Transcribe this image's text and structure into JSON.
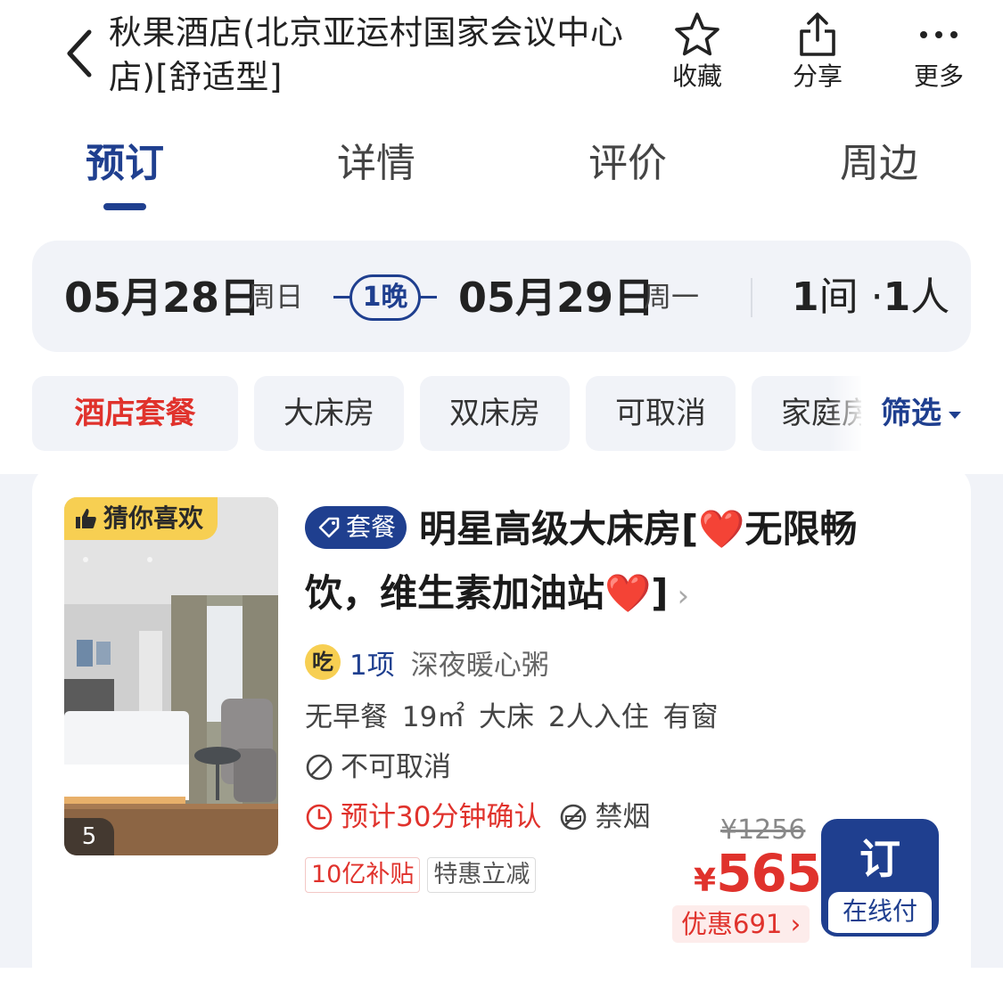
{
  "header": {
    "title": "秋果酒店(北京亚运村国家会议中心店)[舒适型]",
    "actions": [
      {
        "label": "收藏",
        "icon": "star-icon"
      },
      {
        "label": "分享",
        "icon": "share-icon"
      },
      {
        "label": "更多",
        "icon": "more-icon"
      }
    ]
  },
  "tabs": [
    {
      "label": "预订",
      "active": true
    },
    {
      "label": "详情",
      "active": false
    },
    {
      "label": "评价",
      "active": false
    },
    {
      "label": "周边",
      "active": false
    }
  ],
  "stay": {
    "checkin_date": "05月28日",
    "checkin_weekday": "周日",
    "nights": "1晚",
    "checkout_date": "05月29日",
    "checkout_weekday": "周一",
    "rooms_num": "1",
    "rooms_unit": "间",
    "dot": "·",
    "guests_num": "1",
    "guests_unit": "人"
  },
  "filters": {
    "chips": [
      "酒店套餐",
      "大床房",
      "双床房",
      "可取消",
      "家庭房"
    ],
    "filter_label": "筛选"
  },
  "room": {
    "like_badge": "猜你喜欢",
    "photo_count": "5",
    "package_tag": "套餐",
    "name": "明星高级大床房[❤️无限畅饮，维生素加油站❤️]",
    "name_arrow": "›",
    "food_icon": "吃",
    "food_count": "1项",
    "food_desc": "深夜暖心粥",
    "facts": "无早餐 19㎡ 大床 2人入住 有窗",
    "cancel_policy": "不可取消",
    "confirm_time": "预计30分钟确认",
    "smoking": "禁烟",
    "badges": [
      "10亿补贴",
      "特惠立减"
    ],
    "original_price": "¥1256",
    "currency": "¥",
    "price": "565",
    "discount": "优惠691 ›",
    "book_label": "订",
    "pay_label": "在线付"
  },
  "colors": {
    "brand": "#1f3f8f",
    "price_red": "#e0322c",
    "badge_yellow": "#f7cf52",
    "panel_bg": "#f1f3f8"
  }
}
